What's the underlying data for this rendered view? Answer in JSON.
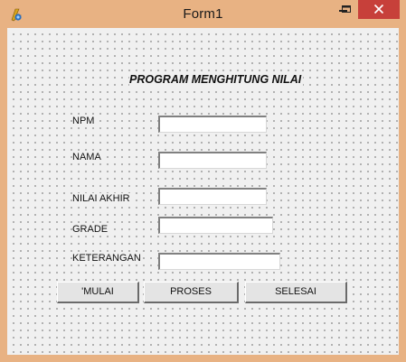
{
  "window": {
    "title": "Form1",
    "controls": {
      "minimize": "minimize-icon",
      "maximize": "maximize-icon",
      "close": "close-icon"
    }
  },
  "form": {
    "heading": "PROGRAM MENGHITUNG NILAI",
    "labels": {
      "npm": "NPM",
      "nama": "NAMA",
      "nilai_akhir": "NILAI AKHIR",
      "grade": "GRADE",
      "keterangan": "KETERANGAN"
    },
    "fields": {
      "npm": "",
      "nama": "",
      "nilai_akhir": "",
      "grade": "",
      "keterangan": ""
    },
    "buttons": {
      "mulai": "'MULAI",
      "proses": "PROSES",
      "selesai": "SELESAI"
    }
  },
  "colors": {
    "frame": "#e8b283",
    "close_button": "#c7403a",
    "client": "#f0f0f0"
  }
}
